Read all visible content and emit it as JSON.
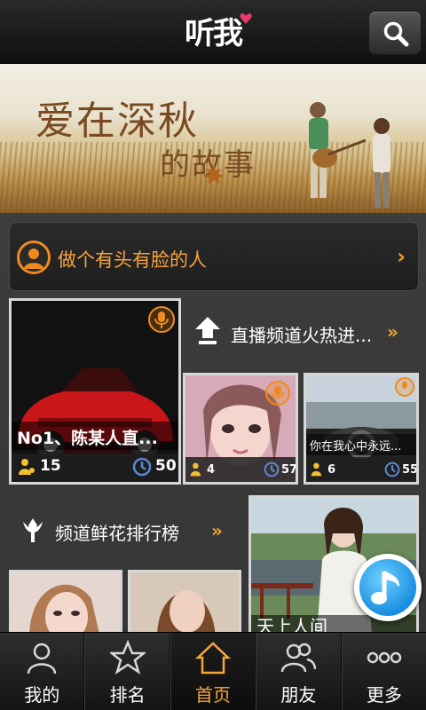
{
  "header": {
    "logo": "听我",
    "search_icon": "search-icon"
  },
  "banner": {
    "title": "爱在深秋",
    "subtitle": "的故事"
  },
  "profile_bar": {
    "text": "做个有头有脸的人",
    "arrow": "›"
  },
  "featured": {
    "caption": "No1、陈某人直...",
    "listeners": "15",
    "views": "50"
  },
  "live_section": {
    "title": "直播频道火热进...",
    "more": "»"
  },
  "tiles": [
    {
      "caption": "",
      "listeners": "4",
      "views": "57"
    },
    {
      "caption": "你在我心中永远...",
      "listeners": "6",
      "views": "55"
    }
  ],
  "flower_section": {
    "title": "频道鲜花排行榜",
    "more": "»"
  },
  "big_tile": {
    "caption": "天上人间"
  },
  "bottom_nav": [
    {
      "label": "我的",
      "icon": "user-icon"
    },
    {
      "label": "排名",
      "icon": "star-rank-icon"
    },
    {
      "label": "首页",
      "icon": "home-icon",
      "active": true
    },
    {
      "label": "朋友",
      "icon": "friends-icon"
    },
    {
      "label": "更多",
      "icon": "more-icon"
    }
  ],
  "colors": {
    "accent": "#f6a637",
    "header_bg": "#1a1a1a",
    "page_bg": "#3a3a3a",
    "mic_orange": "#f08a1d",
    "music_blue": "#1a8fe0"
  }
}
